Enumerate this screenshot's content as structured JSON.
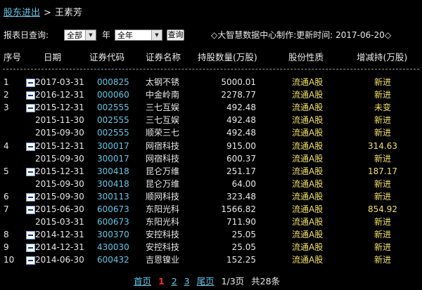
{
  "breadcrumb": {
    "link": "股东进出",
    "separator": ">",
    "current": "王素芳"
  },
  "filter": {
    "label": "报表日查询:",
    "first_select": "全部",
    "year_label": "年",
    "second_select": "全年",
    "query_button": "查询"
  },
  "meta": "◇大智慧数据中心制作:更新时间: 2017-06-20◇",
  "columns": [
    "序号",
    "日期",
    "证券代码",
    "证券名称",
    "持股数量(万股)",
    "股份性质",
    "增减持(万股)"
  ],
  "rows": [
    {
      "seq": "1",
      "icon": true,
      "date": "2017-03-31",
      "code": "000825",
      "name": "太钢不锈",
      "qty": "5000.01",
      "nature": "流通A股",
      "change": "新进"
    },
    {
      "seq": "2",
      "icon": true,
      "date": "2016-12-31",
      "code": "000060",
      "name": "中金岭南",
      "qty": "2278.77",
      "nature": "流通A股",
      "change": "新进"
    },
    {
      "seq": "3",
      "icon": true,
      "date": "2015-12-31",
      "code": "002555",
      "name": "三七互娱",
      "qty": "492.48",
      "nature": "流通A股",
      "change": "未变"
    },
    {
      "seq": "",
      "icon": false,
      "date": "2015-11-30",
      "code": "002555",
      "name": "三七互娱",
      "qty": "492.48",
      "nature": "流通A股",
      "change": "新进"
    },
    {
      "seq": "",
      "icon": false,
      "date": "2015-09-30",
      "code": "002555",
      "name": "顺荣三七",
      "qty": "492.48",
      "nature": "流通A股",
      "change": "新进"
    },
    {
      "seq": "4",
      "icon": true,
      "date": "2015-12-31",
      "code": "300017",
      "name": "网宿科技",
      "qty": "915.00",
      "nature": "流通A股",
      "change": "314.63"
    },
    {
      "seq": "",
      "icon": false,
      "date": "2015-09-30",
      "code": "300017",
      "name": "网宿科技",
      "qty": "600.37",
      "nature": "流通A股",
      "change": "新进"
    },
    {
      "seq": "5",
      "icon": true,
      "date": "2015-12-31",
      "code": "300418",
      "name": "昆仑万维",
      "qty": "251.17",
      "nature": "流通A股",
      "change": "187.17"
    },
    {
      "seq": "",
      "icon": false,
      "date": "2015-09-30",
      "code": "300418",
      "name": "昆仑万维",
      "qty": "64.00",
      "nature": "流通A股",
      "change": "新进"
    },
    {
      "seq": "6",
      "icon": true,
      "date": "2015-09-30",
      "code": "300113",
      "name": "顺网科技",
      "qty": "323.48",
      "nature": "流通A股",
      "change": "新进"
    },
    {
      "seq": "7",
      "icon": true,
      "date": "2015-06-30",
      "code": "600673",
      "name": "东阳光科",
      "qty": "1566.82",
      "nature": "流通A股",
      "change": "854.92"
    },
    {
      "seq": "",
      "icon": false,
      "date": "2015-03-31",
      "code": "600673",
      "name": "东阳光科",
      "qty": "711.90",
      "nature": "流通A股",
      "change": "新进"
    },
    {
      "seq": "8",
      "icon": true,
      "date": "2014-12-31",
      "code": "300370",
      "name": "安控科技",
      "qty": "25.05",
      "nature": "流通A股",
      "change": "新进"
    },
    {
      "seq": "9",
      "icon": true,
      "date": "2014-12-31",
      "code": "430030",
      "name": "安控科技",
      "qty": "25.05",
      "nature": "流通A股",
      "change": "新进"
    },
    {
      "seq": "10",
      "icon": true,
      "date": "2014-06-30",
      "code": "600432",
      "name": "吉恩镍业",
      "qty": "152.25",
      "nature": "流通A股",
      "change": "新进"
    }
  ],
  "pager": {
    "first": "首页",
    "pages": [
      "1",
      "2",
      "3"
    ],
    "current": "1",
    "last": "尾页",
    "page_info": "1/3页",
    "total": "共28条"
  }
}
